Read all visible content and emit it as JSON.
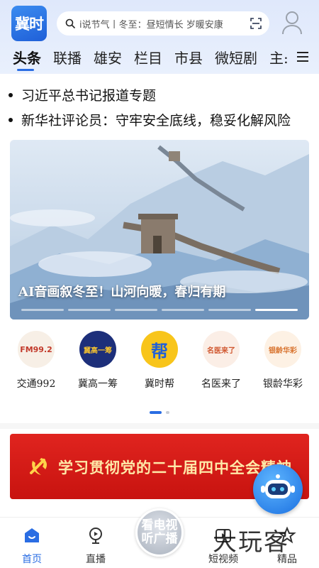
{
  "app": {
    "logo_text": "冀时"
  },
  "search": {
    "text": "i说节气丨冬至：昼短情长 岁暖安康"
  },
  "tabs": [
    {
      "label": "头条",
      "active": true
    },
    {
      "label": "联播"
    },
    {
      "label": "雄安"
    },
    {
      "label": "栏目"
    },
    {
      "label": "市县"
    },
    {
      "label": "微短剧"
    },
    {
      "label": "主:"
    }
  ],
  "news": [
    "习近平总书记报道专题",
    "新华社评论员：守牢安全底线，稳妥化解风险"
  ],
  "banner": {
    "caption": "AI音画叙冬至！山河向暖，春归有期",
    "slides": 6,
    "active_slide": 6
  },
  "shortcuts": [
    {
      "label": "交通992",
      "icon_text": "FM99.2"
    },
    {
      "label": "冀高一筹",
      "icon_text": "冀高一筹"
    },
    {
      "label": "冀时帮",
      "icon_text": "帮"
    },
    {
      "label": "名医来了",
      "icon_text": "名医来了"
    },
    {
      "label": "银龄华彩",
      "icon_text": "银龄华彩"
    }
  ],
  "promo": {
    "text": "学习贯彻党的二十届四中全会精神"
  },
  "bottom_nav": [
    {
      "label": "首页",
      "active": true
    },
    {
      "label": "直播"
    },
    {
      "label": "短视频"
    },
    {
      "label": "精品"
    }
  ],
  "tv_button": {
    "line1": "看电视",
    "line2": "听广播"
  },
  "watermark": "大玩客",
  "colors": {
    "accent": "#2a6de3",
    "promo_red": "#d81e1a",
    "promo_text": "#ffe9a8"
  }
}
